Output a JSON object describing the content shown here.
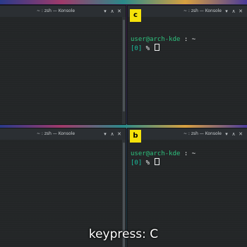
{
  "windows": {
    "top_left": {
      "title": "~ : zsh — Konsole",
      "controls": [
        "▾",
        "∧",
        "✕"
      ]
    },
    "top_right": {
      "title": "~ : zsh — Konsole",
      "controls": [
        "▾",
        "∧",
        "✕"
      ],
      "badge": "c",
      "prompt": {
        "user_host": "user@arch-kde",
        "sep": " : ",
        "path": "~",
        "index": "[0]",
        "symbol": " % "
      }
    },
    "bottom_left": {
      "title": "~ : zsh — Konsole",
      "controls": [
        "▾",
        "∧",
        "✕"
      ]
    },
    "bottom_right": {
      "title": "~ : zsh — Konsole",
      "controls": [
        "▾",
        "∧",
        "✕"
      ],
      "badge": "b",
      "prompt": {
        "user_host": "user@arch-kde",
        "sep": " : ",
        "path": "~",
        "index": "[0]",
        "symbol": " % "
      }
    }
  },
  "caption": "keypress: C",
  "colors": {
    "prompt_user": "#2ec27e",
    "badge": "#f5e20a",
    "terminal_bg": "#232627"
  }
}
